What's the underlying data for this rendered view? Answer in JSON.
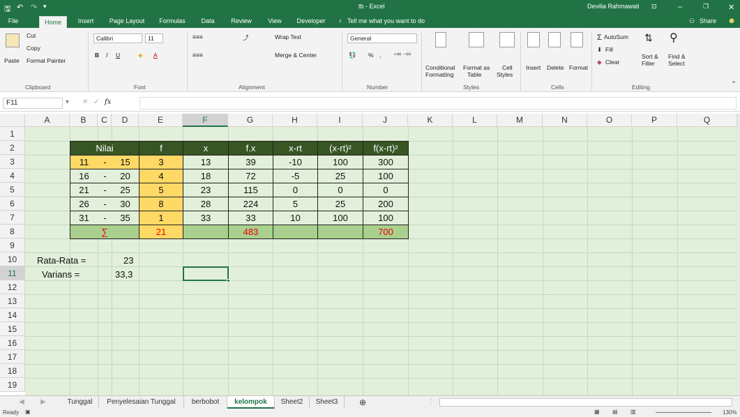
{
  "window": {
    "title": "tb - Excel",
    "user": "Devilia Rahmawati"
  },
  "ribbon_tabs": [
    "File",
    "Home",
    "Insert",
    "Page Layout",
    "Formulas",
    "Data",
    "Review",
    "View",
    "Developer"
  ],
  "tell_me": "Tell me what you want to do",
  "share_label": "Share",
  "clipboard": {
    "paste": "Paste",
    "cut": "Cut",
    "copy": "Copy",
    "format_painter": "Format Painter",
    "group": "Clipboard"
  },
  "font": {
    "name": "Calibri",
    "size": "11",
    "group": "Font"
  },
  "alignment": {
    "wrap": "Wrap Text",
    "merge": "Merge & Center",
    "group": "Alignment"
  },
  "number": {
    "format": "General",
    "percent": "%",
    "comma": ",",
    "group": "Number"
  },
  "styles": {
    "conditional": "Conditional",
    "conditional2": "Formatting",
    "format_as": "Format as",
    "format_as2": "Table",
    "cell": "Cell",
    "cell2": "Styles",
    "group": "Styles"
  },
  "cells": {
    "insert": "Insert",
    "delete": "Delete",
    "format": "Format",
    "group": "Cells"
  },
  "editing": {
    "autosum": "AutoSum",
    "fill": "Fill",
    "clear": "Clear",
    "sort": "Sort &",
    "sort2": "Filter",
    "find": "Find &",
    "find2": "Select",
    "group": "Editing"
  },
  "name_box": "F11",
  "fx": "fx",
  "columns": [
    "A",
    "B",
    "C",
    "D",
    "E",
    "F",
    "G",
    "H",
    "I",
    "J",
    "K",
    "L",
    "M",
    "N",
    "O",
    "P",
    "Q"
  ],
  "rows": [
    "1",
    "2",
    "3",
    "4",
    "5",
    "6",
    "7",
    "8",
    "9",
    "10",
    "11",
    "12",
    "13",
    "14",
    "15",
    "16",
    "17",
    "18",
    "19"
  ],
  "table": {
    "headers": [
      "Nilai",
      "f",
      "x",
      "f.x",
      "x-rt",
      "(x-rt)²",
      "f(x-rt)²"
    ],
    "rows": [
      {
        "lo": "11",
        "dash": "-",
        "hi": "15",
        "f": "3",
        "x": "13",
        "fx": "39",
        "xrt": "-10",
        "sq": "100",
        "fsq": "300"
      },
      {
        "lo": "16",
        "dash": "-",
        "hi": "20",
        "f": "4",
        "x": "18",
        "fx": "72",
        "xrt": "-5",
        "sq": "25",
        "fsq": "100"
      },
      {
        "lo": "21",
        "dash": "-",
        "hi": "25",
        "f": "5",
        "x": "23",
        "fx": "115",
        "xrt": "0",
        "sq": "0",
        "fsq": "0"
      },
      {
        "lo": "26",
        "dash": "-",
        "hi": "30",
        "f": "8",
        "x": "28",
        "fx": "224",
        "xrt": "5",
        "sq": "25",
        "fsq": "200"
      },
      {
        "lo": "31",
        "dash": "-",
        "hi": "35",
        "f": "1",
        "x": "33",
        "fx": "33",
        "xrt": "10",
        "sq": "100",
        "fsq": "100"
      }
    ],
    "sum": {
      "sigma": "∑",
      "f": "21",
      "fx": "483",
      "fsq": "700"
    }
  },
  "summary": {
    "rata_label": "Rata-Rata =",
    "rata_value": "23",
    "varians_label": "Varians =",
    "varians_value": "33,3"
  },
  "sheet_tabs": [
    "Tunggal",
    "Penyelesaian Tunggal",
    "berbobot",
    "kelompok",
    "Sheet2",
    "Sheet3"
  ],
  "active_sheet": "kelompok",
  "status": {
    "ready": "Ready",
    "zoom": "130%"
  },
  "colors": {
    "brand": "#217346",
    "header_fill": "#375623",
    "yellow": "#ffd966",
    "sum_fill": "#a9d08e",
    "sheet_bg": "#e2efda",
    "red": "#ff0000"
  }
}
